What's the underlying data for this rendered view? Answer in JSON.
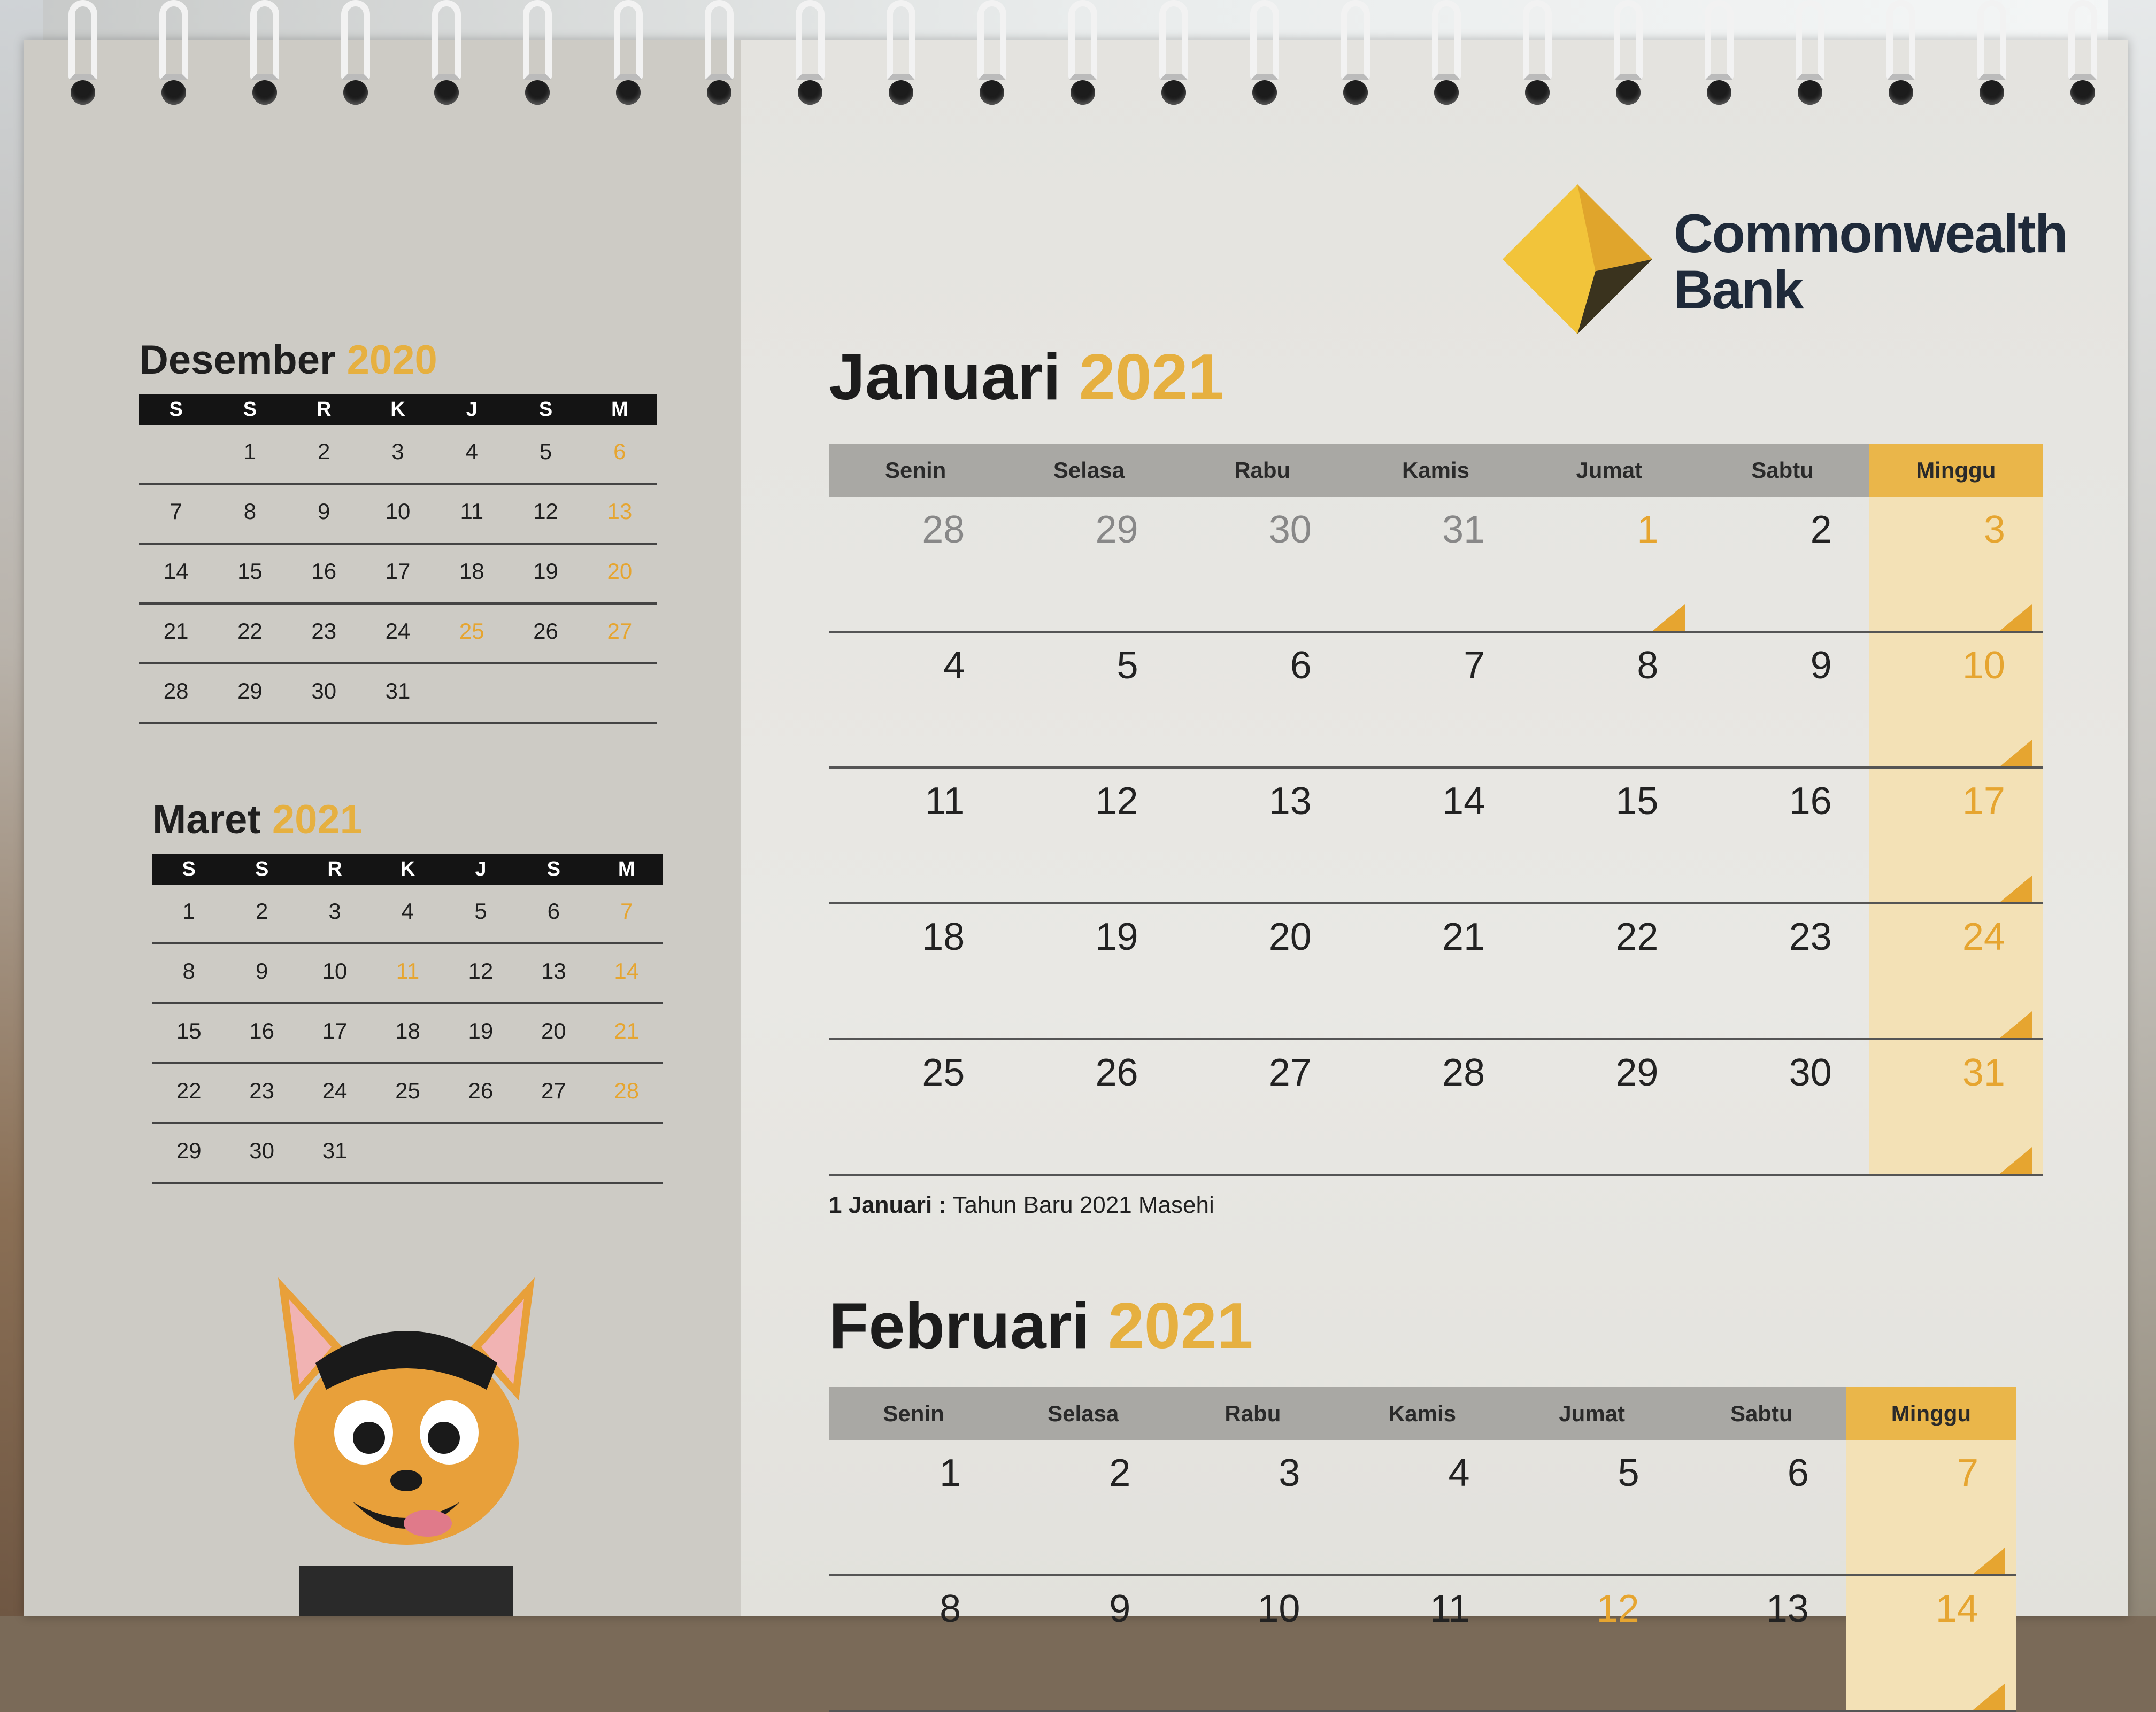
{
  "logo": {
    "line1": "Commonwealth",
    "line2": "Bank",
    "colors": {
      "diamond": "#f2c43a",
      "text": "#1f2a3a"
    }
  },
  "mini_weekday_headers": [
    "S",
    "S",
    "R",
    "K",
    "J",
    "S",
    "M"
  ],
  "mini_calendars": [
    {
      "month": "Desember",
      "year": "2020",
      "rows": [
        [
          "",
          "1",
          "2",
          "3",
          "4",
          "5",
          "6"
        ],
        [
          "7",
          "8",
          "9",
          "10",
          "11",
          "12",
          "13"
        ],
        [
          "14",
          "15",
          "16",
          "17",
          "18",
          "19",
          "20"
        ],
        [
          "21",
          "22",
          "23",
          "24",
          "25",
          "26",
          "27"
        ],
        [
          "28",
          "29",
          "30",
          "31",
          "",
          "",
          ""
        ]
      ]
    },
    {
      "month": "Maret",
      "year": "2021",
      "rows": [
        [
          "1",
          "2",
          "3",
          "4",
          "5",
          "6",
          "7"
        ],
        [
          "8",
          "9",
          "10",
          "11",
          "12",
          "13",
          "14"
        ],
        [
          "15",
          "16",
          "17",
          "18",
          "19",
          "20",
          "21"
        ],
        [
          "22",
          "23",
          "24",
          "25",
          "26",
          "27",
          "28"
        ],
        [
          "29",
          "30",
          "31",
          "",
          "",
          "",
          ""
        ]
      ]
    }
  ],
  "weekday_headers": [
    "Senin",
    "Selasa",
    "Rabu",
    "Kamis",
    "Jumat",
    "Sabtu",
    "Minggu"
  ],
  "months": [
    {
      "month": "Januari",
      "year": "2021",
      "weeks": [
        [
          "28",
          "29",
          "30",
          "31",
          "1",
          "2",
          "3"
        ],
        [
          "4",
          "5",
          "6",
          "7",
          "8",
          "9",
          "10"
        ],
        [
          "11",
          "12",
          "13",
          "14",
          "15",
          "16",
          "17"
        ],
        [
          "18",
          "19",
          "20",
          "21",
          "22",
          "23",
          "24"
        ],
        [
          "25",
          "26",
          "27",
          "28",
          "29",
          "30",
          "31"
        ]
      ],
      "note": {
        "date": "1 Januari :",
        "text": " Tahun Baru 2021 Masehi"
      }
    },
    {
      "month": "Februari",
      "year": "2021",
      "weeks": [
        [
          "1",
          "2",
          "3",
          "4",
          "5",
          "6",
          "7"
        ],
        [
          "8",
          "9",
          "10",
          "11",
          "12",
          "13",
          "14"
        ]
      ]
    }
  ],
  "colors": {
    "accent": "#e6b040",
    "holiday": "#e6a530",
    "sunday_column": "#eab64a",
    "header_gray": "#a9a8a4",
    "mini_header": "#141414"
  }
}
